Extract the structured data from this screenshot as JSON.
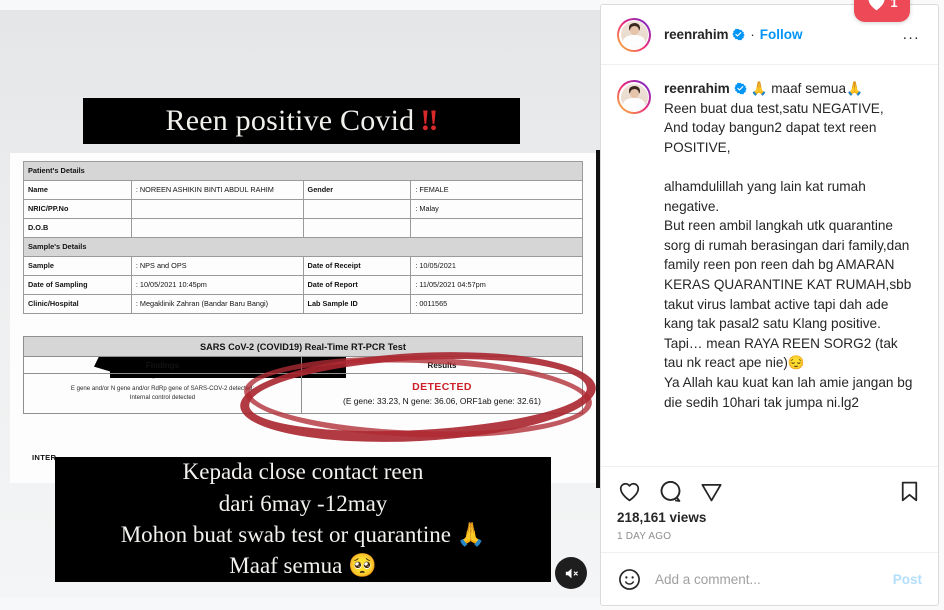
{
  "post": {
    "header": {
      "username": "reenrahim",
      "verified_icon": "verified-badge-icon",
      "separator": "·",
      "follow_label": "Follow",
      "more_options_label": "..."
    },
    "caption": {
      "username": "reenrahim",
      "first_line_emoji": "🙏 maaf semua🙏",
      "body": "Reen buat dua test,satu NEGATIVE,\nAnd today bangun2 dapat text reen POSITIVE,\n\nalhamdulillah yang lain kat rumah negative.\nBut reen ambil langkah utk quarantine sorg di rumah berasingan dari family,dan family reen pon reen dah bg AMARAN KERAS QUARANTINE KAT RUMAH,sbb takut virus lambat active tapi dah ade kang tak pasal2 satu Klang positive.\nTapi… mean RAYA REEN SORG2 (tak tau nk react ape nie)😔\nYa Allah kau kuat kan lah amie jangan bg die sedih 10hari tak jumpa ni.lg2"
    },
    "actions": {
      "like_icon": "heart-icon",
      "comment_icon": "comment-bubble-icon",
      "share_icon": "share-paper-plane-icon",
      "save_icon": "bookmark-icon"
    },
    "stats": {
      "views": "218,161 views",
      "timestamp": "1 DAY AGO"
    },
    "comment_box": {
      "emoji_icon": "smiley-face-icon",
      "placeholder": "Add a comment...",
      "post_label": "Post"
    },
    "like_badge": {
      "icon": "heart-filled-icon",
      "count": "1"
    }
  },
  "media": {
    "mute_icon": "speaker-muted-icon",
    "banner_top": {
      "text": "Reen positive Covid",
      "exclaim": "‼"
    },
    "banner_bottom": {
      "lines": [
        "Kepada close contact reen",
        "dari 6may -12may",
        "Mohon buat swab test or quarantine 🙏",
        "Maaf semua 🥺"
      ]
    },
    "document": {
      "patient_section": "Patient's Details",
      "sample_section": "Sample's Details",
      "rows": [
        {
          "label": "Name",
          "value": ": NOREEN ASHIKIN BINTI ABDUL RAHIM",
          "label2": "Gender",
          "value2": ": FEMALE"
        },
        {
          "label": "NRIC/PP.No",
          "value": "",
          "label2": "",
          "value2": ": Malay"
        },
        {
          "label": "D.O.B",
          "value": "",
          "label2": "",
          "value2": ""
        },
        {
          "label": "Sample",
          "value": ": NPS and OPS",
          "label2": "Date of Receipt",
          "value2": ": 10/05/2021"
        },
        {
          "label": "Date of Sampling",
          "value": ": 10/05/2021 10:45pm",
          "label2": "Date of Report",
          "value2": ": 11/05/2021 04:57pm"
        },
        {
          "label": "Clinic/Hospital",
          "value": ": Megaklinik Zahran (Bandar Baru Bangi)",
          "label2": "Lab Sample ID",
          "value2": ": 0011565"
        }
      ],
      "test_title": "SARS CoV-2 (COVID19) Real-Time RT-PCR Test",
      "col_findings": "Findings",
      "col_results": "Results",
      "findings_text": "E gene and/or N gene and/or RdRp gene of SARS-COV-2 detected;\nInternal control detected",
      "result_label": "DETECTED",
      "result_genes": "(E gene: 33.23, N gene: 36.06, ORF1ab gene: 32.61)",
      "interpretation_label": "INTER"
    }
  },
  "colors": {
    "instagram_blue": "#0095f6",
    "like_red": "#ed4956",
    "detected_red": "#cc1f28",
    "circle_mark_red": "#a8252f"
  }
}
